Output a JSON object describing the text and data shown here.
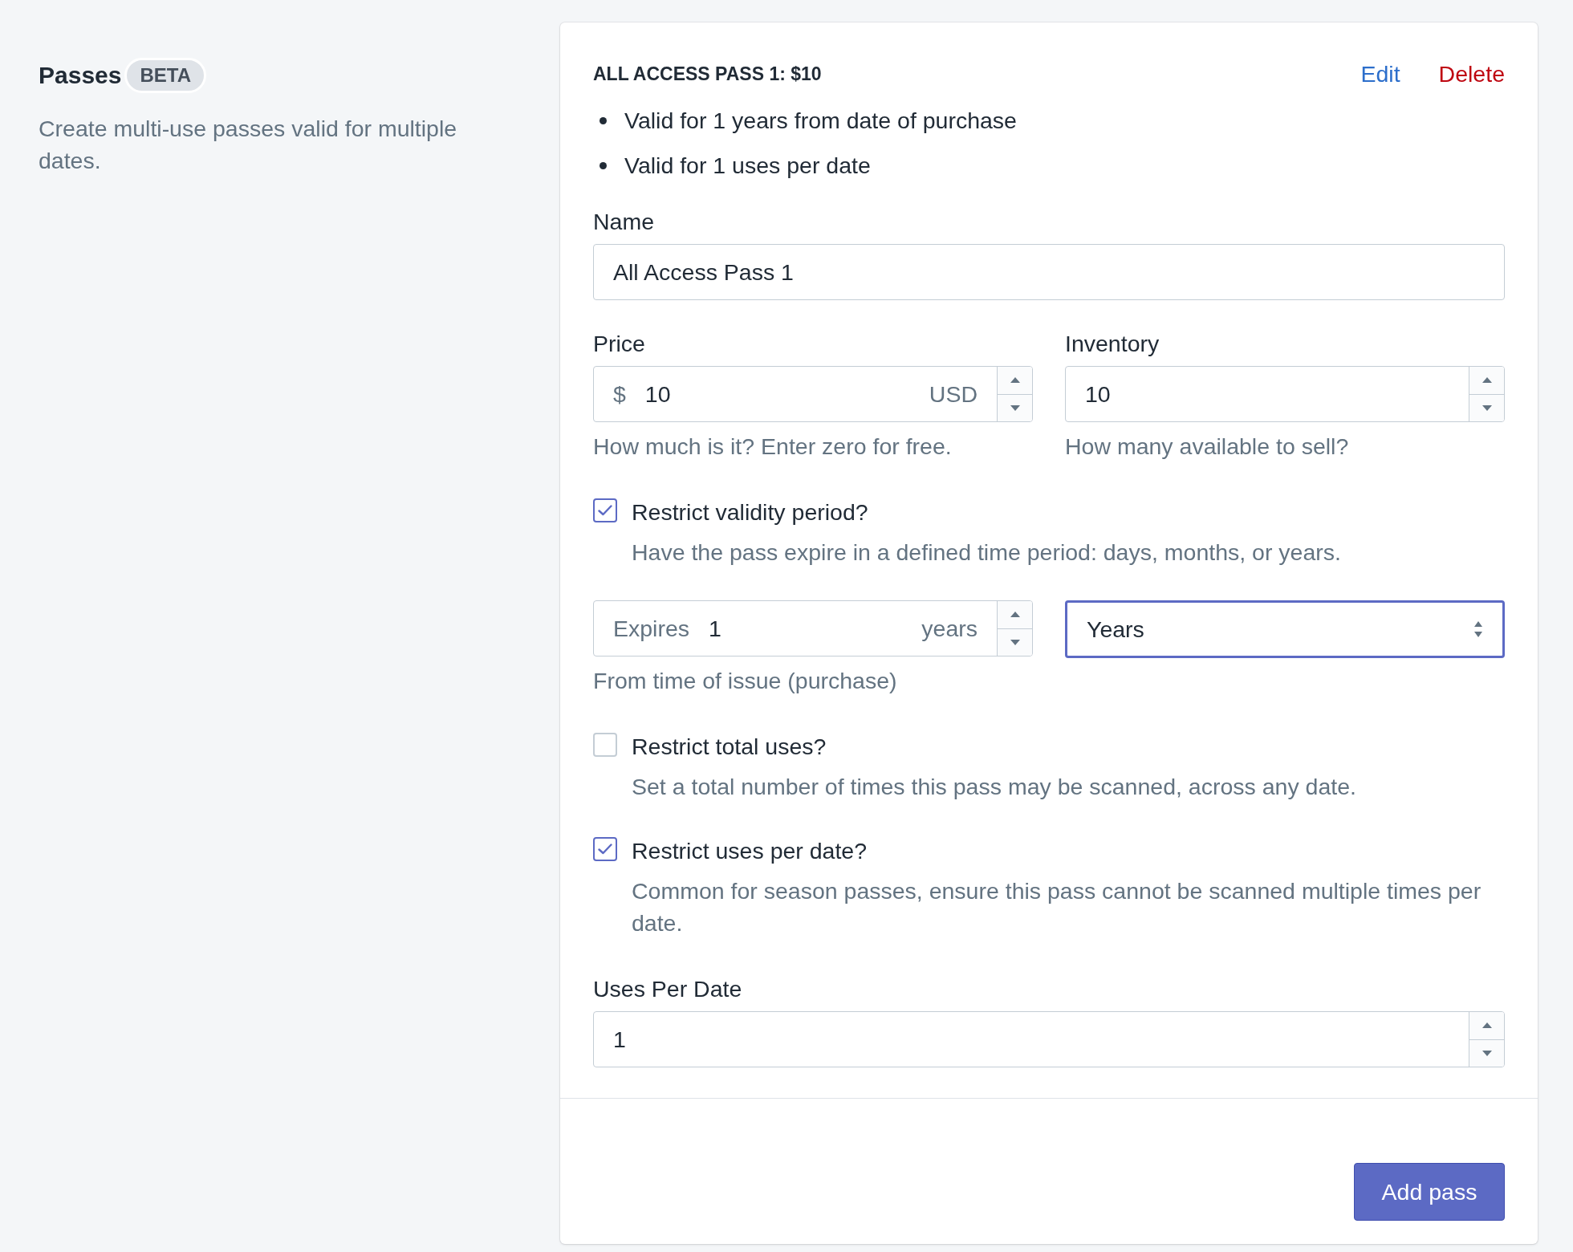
{
  "section": {
    "title": "Passes",
    "badge": "BETA",
    "description": "Create multi-use passes valid for multiple dates."
  },
  "pass": {
    "heading": "ALL ACCESS PASS 1: $10",
    "actions": [
      {
        "label": "Edit",
        "kind": "edit"
      },
      {
        "label": "Delete",
        "kind": "delete"
      }
    ],
    "summary": [
      "Valid for 1 years from date of purchase",
      "Valid for 1 uses per date"
    ]
  },
  "name": {
    "label": "Name",
    "value": "All Access Pass 1"
  },
  "price": {
    "label": "Price",
    "prefix": "$",
    "value": "10",
    "suffix": "USD",
    "help": "How much is it? Enter zero for free."
  },
  "inventory": {
    "label": "Inventory",
    "value": "10",
    "help": "How many available to sell?"
  },
  "options": [
    {
      "label": "Restrict validity period?",
      "description": "Have the pass expire in a defined time period: days, months, or years.",
      "checked": true
    },
    {
      "label": "Restrict total uses?",
      "description": "Set a total number of times this pass may be scanned, across any date.",
      "checked": false
    },
    {
      "label": "Restrict uses per date?",
      "description": "Common for season passes, ensure this pass cannot be scanned multiple times per date.",
      "checked": true
    }
  ],
  "expiry": {
    "prefix": "Expires",
    "value": "1",
    "suffix": "years",
    "help": "From time of issue (purchase)",
    "unit": {
      "value": "Years",
      "focused": true
    }
  },
  "uses_per_date": {
    "label": "Uses Per Date",
    "value": "1"
  },
  "submit": "Add pass"
}
